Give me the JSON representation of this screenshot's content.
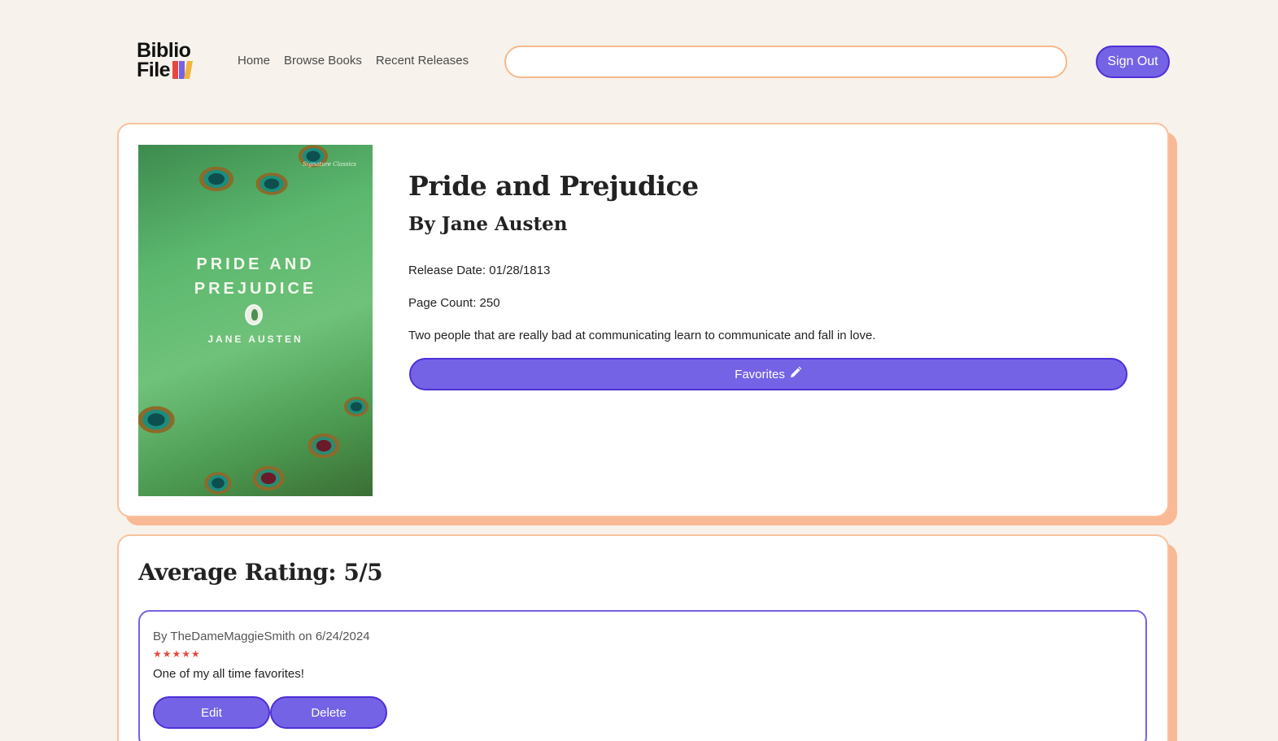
{
  "header": {
    "logo_line1": "Biblio",
    "logo_line2": "File",
    "nav": [
      "Home",
      "Browse Books",
      "Recent Releases"
    ],
    "search_value": "",
    "sign_out_label": "Sign Out"
  },
  "book": {
    "title": "Pride and Prejudice",
    "author_line": "By Jane Austen",
    "release_date": "Release Date: 01/28/1813",
    "page_count": "Page Count: 250",
    "description": "Two people that are really bad at communicating learn to communicate and fall in love.",
    "favorites_label": "Favorites",
    "cover": {
      "small_text": "Signature Classics",
      "title": "PRIDE AND PREJUDICE",
      "author": "JANE AUSTEN"
    }
  },
  "ratings": {
    "average_label": "Average Rating: 5/5",
    "reviews": [
      {
        "byline": "By TheDameMaggieSmith on 6/24/2024",
        "stars": "★★★★★",
        "rating": 5,
        "text": "One of my all time favorites!",
        "edit_label": "Edit",
        "delete_label": "Delete"
      }
    ]
  },
  "colors": {
    "background": "#f7f2eb",
    "accent": "#7563e6",
    "accent_border": "#4f2fd8",
    "card_shadow": "#f9b994",
    "card_border": "#f9c19d",
    "star": "#e8473f"
  }
}
